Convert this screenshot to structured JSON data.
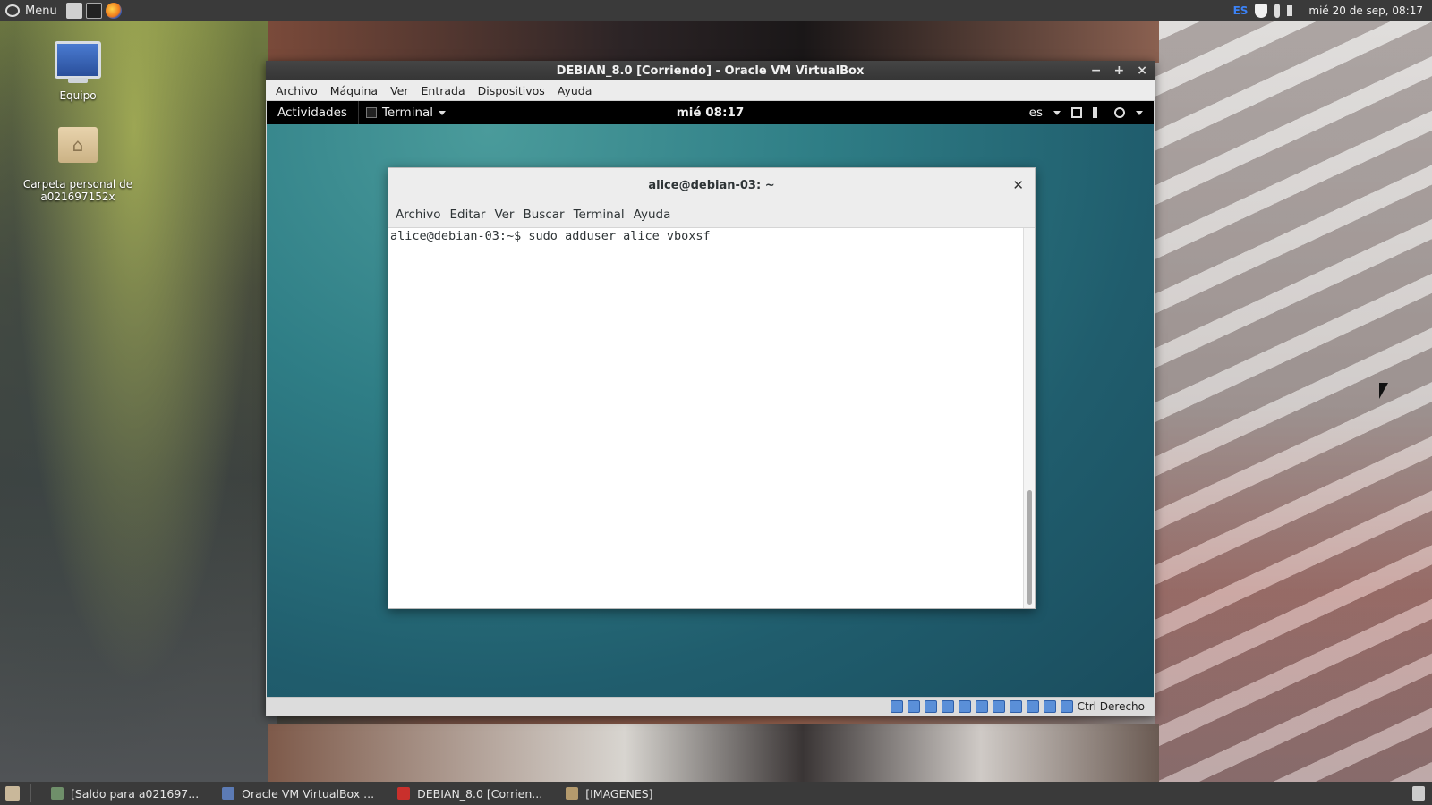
{
  "top_panel": {
    "menu_label": "Menu",
    "keyboard_layout": "ES",
    "clock": "mié 20 de sep, 08:17"
  },
  "desktop": {
    "icons": [
      {
        "label": "Equipo"
      },
      {
        "label": "Carpeta personal de\na021697152x"
      }
    ]
  },
  "vbox": {
    "title": "DEBIAN_8.0 [Corriendo] - Oracle VM VirtualBox",
    "menu": [
      "Archivo",
      "Máquina",
      "Ver",
      "Entrada",
      "Dispositivos",
      "Ayuda"
    ],
    "status_hostkey": "Ctrl Derecho"
  },
  "guest_panel": {
    "activities": "Actividades",
    "app": "Terminal",
    "clock": "mié 08:17",
    "lang": "es"
  },
  "terminal": {
    "title": "alice@debian-03: ~",
    "menu": [
      "Archivo",
      "Editar",
      "Ver",
      "Buscar",
      "Terminal",
      "Ayuda"
    ],
    "lines": [
      "alice@debian-03:~$ sudo adduser alice vboxsf"
    ]
  },
  "taskbar": {
    "tasks": [
      {
        "label": "[Saldo para a021697..."
      },
      {
        "label": "Oracle VM VirtualBox ..."
      },
      {
        "label": "DEBIAN_8.0 [Corrien..."
      },
      {
        "label": "[IMAGENES]"
      }
    ]
  }
}
